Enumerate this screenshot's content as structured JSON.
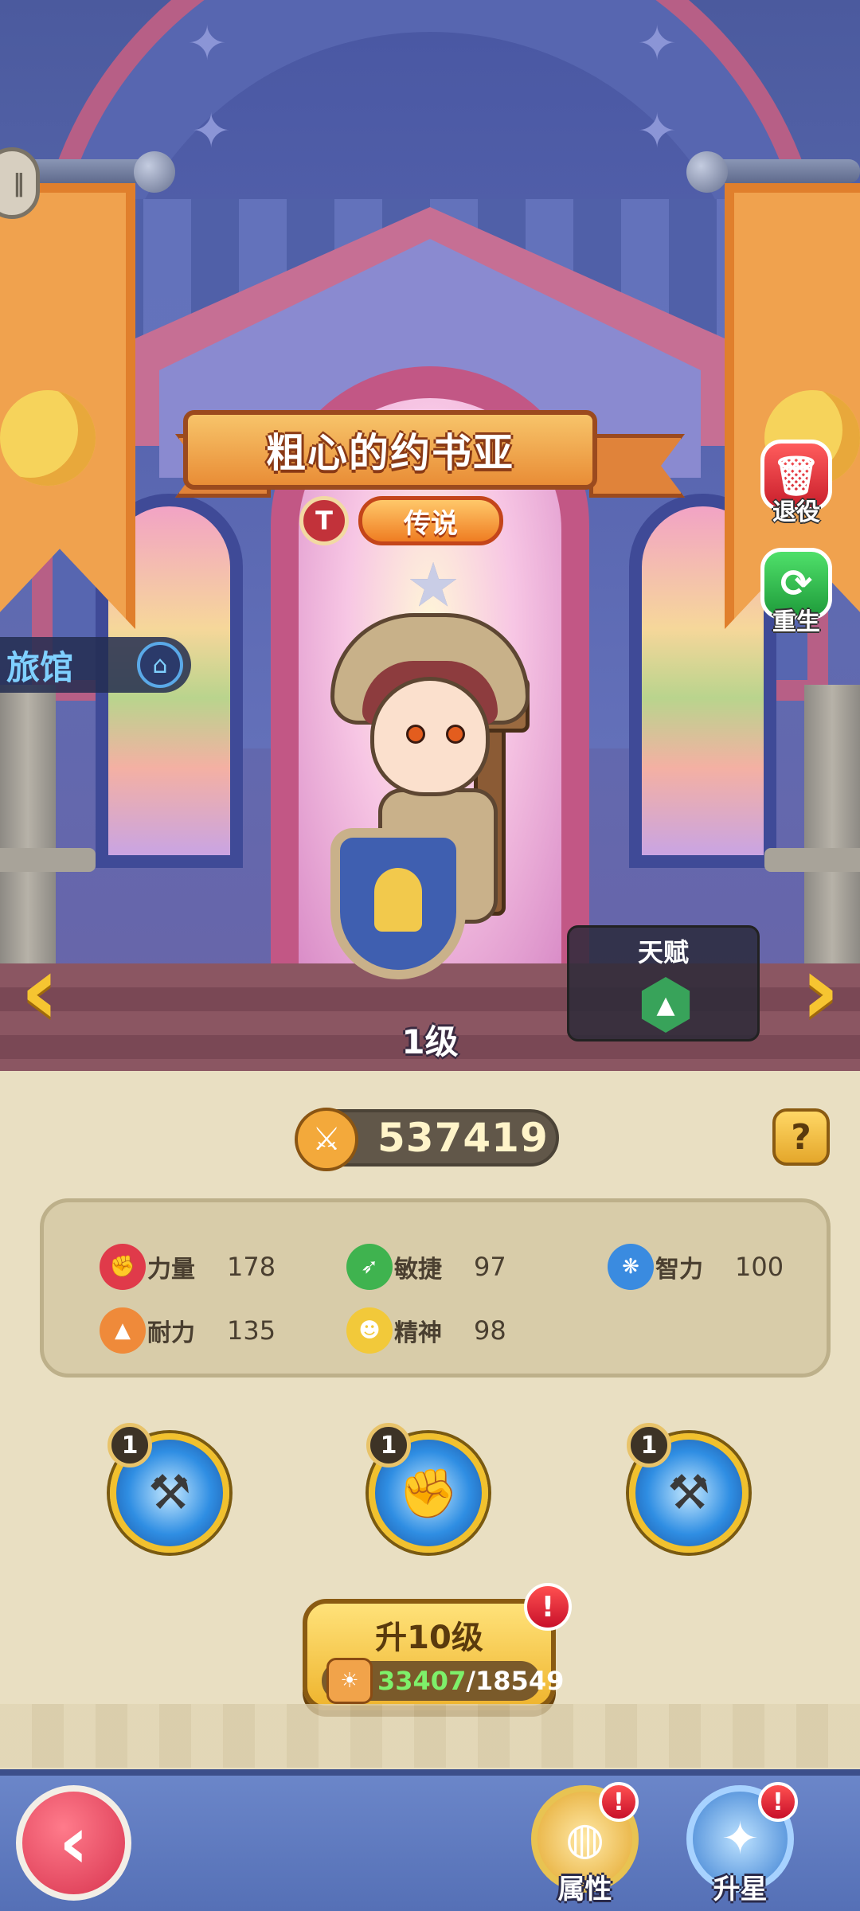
{
  "hero": {
    "name": "粗心的约书亚",
    "rarity": "传说",
    "class_icon": "hammer-icon",
    "level": "1级",
    "stars": 1
  },
  "side_actions": {
    "retire": "退役",
    "rebirth": "重生"
  },
  "location": {
    "label": "旅馆"
  },
  "talent": {
    "title": "天赋",
    "icon": "flame-hexagon-icon"
  },
  "power": {
    "value": "537419",
    "icon": "sword-shield-icon"
  },
  "stats": [
    {
      "name": "力量",
      "value": "178",
      "icon": "strength-icon",
      "color": "#e03a4a"
    },
    {
      "name": "敏捷",
      "value": "97",
      "icon": "agility-icon",
      "color": "#3fb34f"
    },
    {
      "name": "智力",
      "value": "100",
      "icon": "intellect-icon",
      "color": "#3a8be0"
    },
    {
      "name": "耐力",
      "value": "135",
      "icon": "stamina-icon",
      "color": "#ef8a3a"
    },
    {
      "name": "精神",
      "value": "98",
      "icon": "spirit-icon",
      "color": "#f2c93a"
    }
  ],
  "skills": [
    {
      "level": "1",
      "icon": "hammer-skill-icon"
    },
    {
      "level": "1",
      "icon": "fist-skill-icon"
    },
    {
      "level": "1",
      "icon": "holy-hammer-skill-icon"
    }
  ],
  "upgrade": {
    "label": "升10级",
    "have": "33407",
    "need": "/18549",
    "alert": "!"
  },
  "bottom_tabs": [
    {
      "label": "属性",
      "alert": "!"
    },
    {
      "label": "升星",
      "alert": "!"
    }
  ],
  "help": "?",
  "colors": {
    "panel_bg": "#e9dfc2",
    "gold": "#efb52f",
    "alert_red": "#c8102a"
  }
}
